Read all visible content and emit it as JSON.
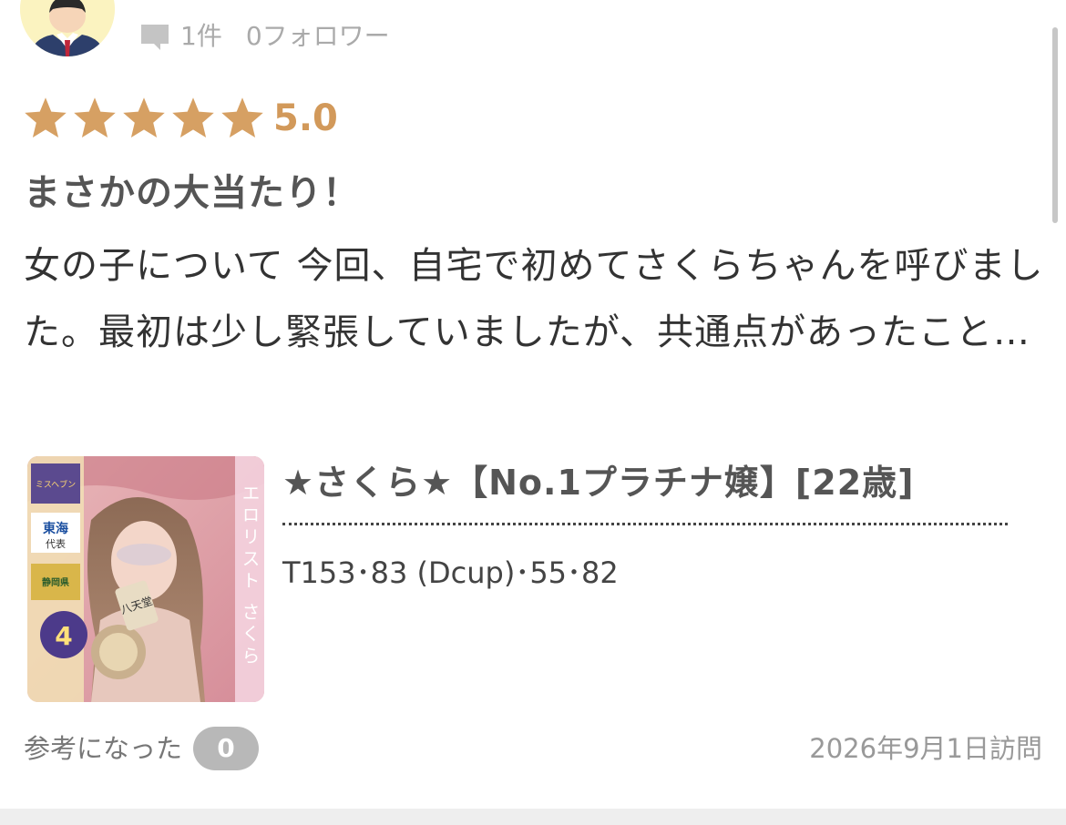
{
  "reviewer": {
    "review_count": "1件",
    "followers": "0フォロワー"
  },
  "review": {
    "stars_filled": 5,
    "stars_total": 5,
    "rating": "5.0",
    "title": "まさかの大当たり！",
    "body": "女の子について 今回、自宅で初めてさくらちゃんを呼びました。最初は少し緊張していましたが、共通点があったこと…"
  },
  "cast": {
    "name": "★さくら★【No.1プラチナ嬢】[22歳]",
    "specs": "T153･83 (Dcup)･55･82",
    "photo_text": {
      "badge_top": "ミスヘブン",
      "badge_region": "東海",
      "badge_sub": "代表",
      "badge_pref": "静岡県",
      "badge_rank": "4",
      "vertical_label": "エロリスト さくら",
      "food_label": "八天堂"
    }
  },
  "footer": {
    "helpful_label": "参考になった",
    "helpful_count": "0",
    "visit_date": "2026年9月1日訪問"
  },
  "colors": {
    "star": "#d6a063",
    "rating_text": "#d2995a",
    "badge_bg": "#b8b8b8",
    "avatar_bg": "#fbf3c0"
  },
  "icons": {
    "reviews": "comment-icon",
    "star": "star-icon"
  }
}
